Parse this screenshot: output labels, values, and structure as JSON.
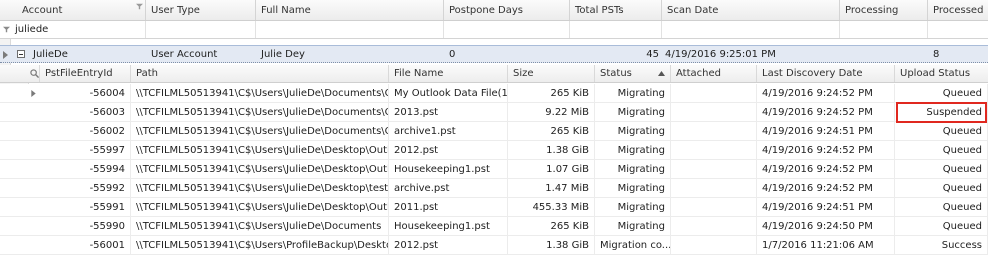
{
  "top_columns": {
    "account": "Account",
    "user_type": "User Type",
    "full_name": "Full Name",
    "postpone_days": "Postpone Days",
    "total_psts": "Total PSTs",
    "scan_date": "Scan Date",
    "processing": "Processing",
    "processed": "Processed"
  },
  "filter": {
    "account_value": "juliede"
  },
  "group": {
    "account": "JulieDe",
    "user_type": "User Account",
    "full_name": "Julie Dey",
    "postpone_days": "0",
    "total_psts": "45",
    "scan_date": "4/19/2016 9:25:01 PM",
    "processed": "8"
  },
  "detail_columns": {
    "id": "PstFileEntryId",
    "path": "Path",
    "file_name": "File Name",
    "size": "Size",
    "status": "Status",
    "attached": "Attached",
    "last_discovery": "Last Discovery Date",
    "upload_status": "Upload Status"
  },
  "rows": [
    {
      "id": "-56004",
      "path": "\\\\TCFILML50513941\\C$\\Users\\JulieDe\\Documents\\Ou...",
      "file_name": "My Outlook Data File(1)...",
      "size": "265 KiB",
      "status": "Migrating",
      "attached": "",
      "last_discovery": "4/19/2016 9:24:52 PM",
      "upload_status": "Queued"
    },
    {
      "id": "-56003",
      "path": "\\\\TCFILML50513941\\C$\\Users\\JulieDe\\Documents\\Ou...",
      "file_name": "2013.pst",
      "size": "9.22 MiB",
      "status": "Migrating",
      "attached": "",
      "last_discovery": "4/19/2016 9:24:52 PM",
      "upload_status": "Suspended"
    },
    {
      "id": "-56002",
      "path": "\\\\TCFILML50513941\\C$\\Users\\JulieDe\\Documents\\Ou...",
      "file_name": "archive1.pst",
      "size": "265 KiB",
      "status": "Migrating",
      "attached": "",
      "last_discovery": "4/19/2016 9:24:51 PM",
      "upload_status": "Queued"
    },
    {
      "id": "-55997",
      "path": "\\\\TCFILML50513941\\C$\\Users\\JulieDe\\Desktop\\Outlo...",
      "file_name": "2012.pst",
      "size": "1.38 GiB",
      "status": "Migrating",
      "attached": "",
      "last_discovery": "4/19/2016 9:24:52 PM",
      "upload_status": "Queued"
    },
    {
      "id": "-55994",
      "path": "\\\\TCFILML50513941\\C$\\Users\\JulieDe\\Desktop\\Outlo...",
      "file_name": "Housekeeping1.pst",
      "size": "1.07 GiB",
      "status": "Migrating",
      "attached": "",
      "last_discovery": "4/19/2016 9:24:52 PM",
      "upload_status": "Queued"
    },
    {
      "id": "-55992",
      "path": "\\\\TCFILML50513941\\C$\\Users\\JulieDe\\Desktop\\test",
      "file_name": "archive.pst",
      "size": "1.47 MiB",
      "status": "Migrating",
      "attached": "",
      "last_discovery": "4/19/2016 9:24:52 PM",
      "upload_status": "Queued"
    },
    {
      "id": "-55991",
      "path": "\\\\TCFILML50513941\\C$\\Users\\JulieDe\\Desktop\\Outlo...",
      "file_name": "2011.pst",
      "size": "455.33 MiB",
      "status": "Migrating",
      "attached": "",
      "last_discovery": "4/19/2016 9:24:51 PM",
      "upload_status": "Queued"
    },
    {
      "id": "-55990",
      "path": "\\\\TCFILML50513941\\C$\\Users\\JulieDe\\Documents",
      "file_name": "Housekeeping1.pst",
      "size": "265 KiB",
      "status": "Migrating",
      "attached": "",
      "last_discovery": "4/19/2016 9:24:50 PM",
      "upload_status": "Queued"
    },
    {
      "id": "-56001",
      "path": "\\\\TCFILML50513941\\C$\\Users\\ProfileBackup\\Desktop...",
      "file_name": "2012.pst",
      "size": "1.38 GiB",
      "status": "Migration co...",
      "attached": "",
      "last_discovery": "1/7/2016 11:21:06 AM",
      "upload_status": "Success"
    }
  ],
  "colors": {
    "highlight": "#e0281f",
    "group_bg": "#e3e9f3"
  },
  "icons": {
    "filter": "filter-icon",
    "search": "search-icon",
    "sort": "sort-ascending-icon",
    "expand": "expand-collapse-icon",
    "row_indicator": "row-indicator-icon"
  }
}
